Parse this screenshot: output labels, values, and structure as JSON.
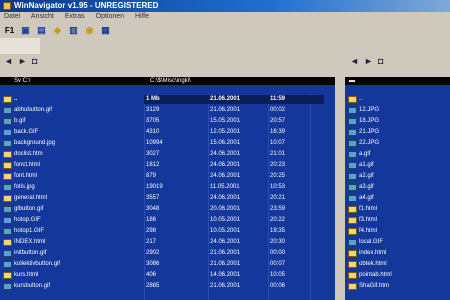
{
  "window": {
    "title": "WinNavigator v1.95 - UNREGISTERED"
  },
  "menu": [
    "Datei",
    "Ansicht",
    "Extras",
    "Optionen",
    "Hilfe"
  ],
  "toolbar": {
    "f1_label": "F1",
    "icons": [
      "copy-icon",
      "move-icon",
      "new-folder-icon",
      "delete-icon",
      "refresh-icon",
      "view-icon"
    ]
  },
  "left_panel": {
    "path": "C:\\$\\Misc\\ingkl\\",
    "header": "Sv  C:\\",
    "parent_row": {
      "name": "..",
      "size": "1 Mb",
      "date": "21.06.2001",
      "time": "11:59"
    },
    "files": [
      {
        "name": "abhubutton.gif",
        "size": "3129",
        "date": "21.06.2001",
        "time": "00:02",
        "type": "img"
      },
      {
        "name": "b.gif",
        "size": "3705",
        "date": "15.05.2001",
        "time": "20:57",
        "type": "img"
      },
      {
        "name": "back.GIF",
        "size": "4310",
        "date": "12.05.2001",
        "time": "16:39",
        "type": "img"
      },
      {
        "name": "background.jpg",
        "size": "10994",
        "date": "15.06.2001",
        "time": "10:07",
        "type": "img"
      },
      {
        "name": "doclist.htm",
        "size": "3027",
        "date": "24.06.2001",
        "time": "21:01",
        "type": "doc"
      },
      {
        "name": "fonct.html",
        "size": "1812",
        "date": "24.06.2001",
        "time": "20:23",
        "type": "doc"
      },
      {
        "name": "font.html",
        "size": "879",
        "date": "24.06.2001",
        "time": "20:25",
        "type": "doc"
      },
      {
        "name": "fotis.jpg",
        "size": "19019",
        "date": "11.05.2001",
        "time": "10:53",
        "type": "img"
      },
      {
        "name": "general.html",
        "size": "3557",
        "date": "24.06.2001",
        "time": "20:21",
        "type": "doc"
      },
      {
        "name": "glbutton.gif",
        "size": "3048",
        "date": "20.06.2001",
        "time": "23:59",
        "type": "img"
      },
      {
        "name": "hotop.GIF",
        "size": "186",
        "date": "10.05.2001",
        "time": "20:22",
        "type": "img"
      },
      {
        "name": "hotop1.GIF",
        "size": "298",
        "date": "10.05.2001",
        "time": "19:35",
        "type": "img"
      },
      {
        "name": "INDEX.html",
        "size": "217",
        "date": "24.06.2001",
        "time": "20:30",
        "type": "doc"
      },
      {
        "name": "initbutton.gif",
        "size": "2902",
        "date": "21.06.2001",
        "time": "00:00",
        "type": "img"
      },
      {
        "name": "kollektivbutton.gif",
        "size": "3086",
        "date": "21.06.2001",
        "time": "00:07",
        "type": "img"
      },
      {
        "name": "kurs.html",
        "size": "406",
        "date": "14.06.2001",
        "time": "10:05",
        "type": "doc"
      },
      {
        "name": "kursbutton.gif",
        "size": "2885",
        "date": "21.06.2001",
        "time": "00:06",
        "type": "img"
      }
    ]
  },
  "right_panel": {
    "files": [
      {
        "name": "..",
        "type": "doc"
      },
      {
        "name": "12.JPG",
        "type": "img"
      },
      {
        "name": "18.JPG",
        "type": "img"
      },
      {
        "name": "21.JPG",
        "type": "img"
      },
      {
        "name": "22.JPG",
        "type": "img"
      },
      {
        "name": "a.gif",
        "type": "img"
      },
      {
        "name": "a1.gif",
        "type": "img"
      },
      {
        "name": "a2.gif",
        "type": "img"
      },
      {
        "name": "a3.gif",
        "type": "img"
      },
      {
        "name": "a4.gif",
        "type": "img"
      },
      {
        "name": "f1.html",
        "type": "doc"
      },
      {
        "name": "f3.html",
        "type": "doc"
      },
      {
        "name": "f4.html",
        "type": "doc"
      },
      {
        "name": "local.GIF",
        "type": "img"
      },
      {
        "name": "index.html",
        "type": "doc"
      },
      {
        "name": "obtek.html",
        "type": "doc"
      },
      {
        "name": "pointab.html",
        "type": "doc"
      },
      {
        "name": "ShaGif.htm",
        "type": "doc"
      }
    ]
  }
}
